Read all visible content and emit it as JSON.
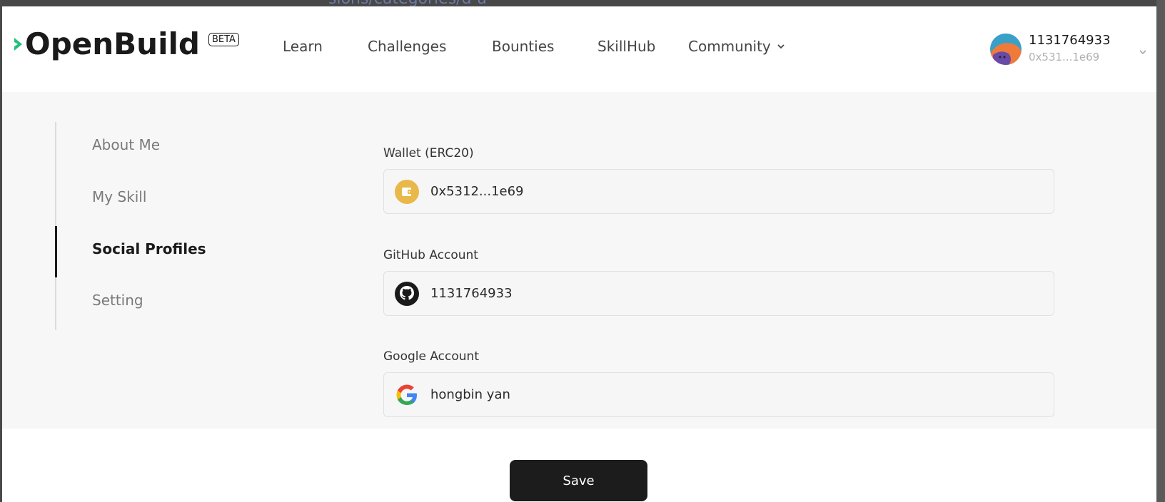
{
  "background": {
    "url_fragment": "sions/categories/d-a"
  },
  "header": {
    "logo_text": "OpenBuild",
    "beta_badge": "BETA",
    "nav": {
      "learn": "Learn",
      "challenges": "Challenges",
      "bounties": "Bounties",
      "skillhub": "SkillHub",
      "community": "Community"
    },
    "user": {
      "name": "1131764933",
      "address": "0x531...1e69"
    }
  },
  "sidebar": {
    "items": [
      {
        "label": "About Me",
        "active": false
      },
      {
        "label": "My Skill",
        "active": false
      },
      {
        "label": "Social Profiles",
        "active": true
      },
      {
        "label": "Setting",
        "active": false
      }
    ]
  },
  "form": {
    "wallet": {
      "label": "Wallet (ERC20)",
      "value": "0x5312...1e69",
      "icon": "wallet-icon"
    },
    "github": {
      "label": "GitHub Account",
      "value": "1131764933",
      "icon": "github-icon"
    },
    "google": {
      "label": "Google Account",
      "value": "hongbin yan",
      "icon": "google-icon"
    }
  },
  "actions": {
    "save_label": "Save"
  },
  "colors": {
    "primary": "#1c1c1c",
    "wallet_icon": "#e9b84a",
    "content_bg": "#f7f7f7"
  }
}
